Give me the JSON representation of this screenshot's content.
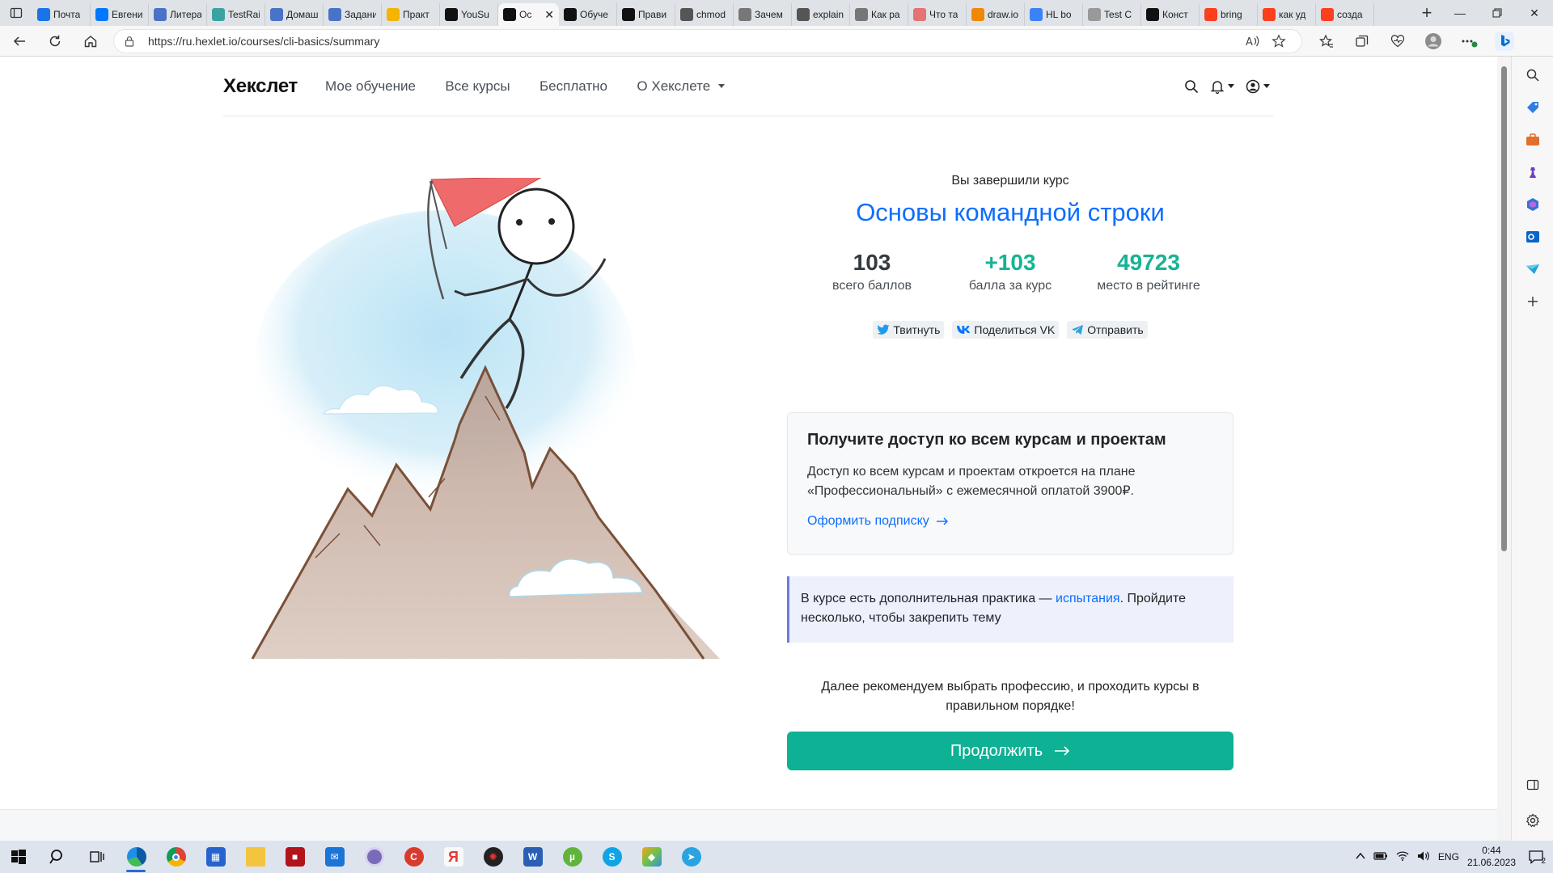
{
  "browser": {
    "tabs": [
      {
        "title": "",
        "favicon": "tab-actions-icon"
      },
      {
        "title": "Почта",
        "favicon": "mail-icon",
        "color": "#1a73e8"
      },
      {
        "title": "Евгений",
        "favicon": "vk-icon",
        "color": "#0077ff"
      },
      {
        "title": "Литера",
        "favicon": "doc-icon",
        "color": "#4a73c6"
      },
      {
        "title": "TestRail",
        "favicon": "testrail-icon",
        "color": "#3aa3a0"
      },
      {
        "title": "Домашн",
        "favicon": "doc-icon",
        "color": "#4a73c6"
      },
      {
        "title": "Задани",
        "favicon": "doc-icon",
        "color": "#4a73c6"
      },
      {
        "title": "Практ",
        "favicon": "drive-icon",
        "color": "#f4b400"
      },
      {
        "title": "YouSu",
        "favicon": "github-icon",
        "color": "#111111"
      },
      {
        "title": "Ос",
        "favicon": "hexlet-icon",
        "color": "#111111",
        "active": true
      },
      {
        "title": "Обуче",
        "favicon": "hexlet-icon",
        "color": "#111111"
      },
      {
        "title": "Прави",
        "favicon": "hexlet-icon",
        "color": "#111111"
      },
      {
        "title": "chmod",
        "favicon": "wikipedia-icon",
        "color": "#555555"
      },
      {
        "title": "Зачем",
        "favicon": "hexlet-icon",
        "color": "#777777"
      },
      {
        "title": "explain",
        "favicon": "feather-icon",
        "color": "#555555"
      },
      {
        "title": "Как ра",
        "favicon": "hexlet-icon",
        "color": "#777777"
      },
      {
        "title": "Что та",
        "favicon": "circle-icon",
        "color": "#e57373"
      },
      {
        "title": "draw.io",
        "favicon": "drawio-icon",
        "color": "#f08705"
      },
      {
        "title": "HL bo",
        "favicon": "diamond-icon",
        "color": "#3b82f6"
      },
      {
        "title": "Test C",
        "favicon": "page-icon",
        "color": "#999999"
      },
      {
        "title": "Конст",
        "favicon": "check-icon",
        "color": "#111111"
      },
      {
        "title": "bring",
        "favicon": "yandex-icon",
        "color": "#fc3f1d"
      },
      {
        "title": "как уд",
        "favicon": "yandex-icon",
        "color": "#fc3f1d"
      },
      {
        "title": "созда",
        "favicon": "yandex-icon",
        "color": "#fc3f1d"
      }
    ],
    "url": "https://ru.hexlet.io/courses/cli-basics/summary"
  },
  "site": {
    "logo": "Хекслет",
    "nav": [
      "Мое обучение",
      "Все курсы",
      "Бесплатно",
      "О Хекслете"
    ]
  },
  "summary": {
    "done_label": "Вы завершили курс",
    "course_title": "Основы командной строки",
    "stats": [
      {
        "value": "103",
        "label": "всего баллов",
        "color": "#343a40"
      },
      {
        "value": "+103",
        "label": "балла за курс",
        "color": "#17b394"
      },
      {
        "value": "49723",
        "label": "место в рейтинге",
        "color": "#17b394"
      }
    ],
    "share": [
      "Твитнуть",
      "Поделиться VK",
      "Отправить"
    ]
  },
  "access_card": {
    "title": "Получите доступ ко всем курсам и проектам",
    "text": "Доступ ко всем курсам и проектам откроется на плане «Профессиональный» с ежемесячной оплатой 3900₽.",
    "link": "Оформить подписку"
  },
  "practice_card": {
    "text_before": "В курсе есть дополнительная практика — ",
    "link": "испытания",
    "text_after": ". Пройдите несколько, чтобы закрепить тему"
  },
  "recommend": "Далее рекомендуем выбрать профессию, и проходить курсы в правильном порядке!",
  "continue_label": "Продолжить",
  "taskbar": {
    "lang": "ENG",
    "time": "0:44",
    "date": "21.06.2023",
    "notifications": "2",
    "apps": [
      {
        "name": "search-icon"
      },
      {
        "name": "task-view-icon"
      },
      {
        "name": "edge-icon",
        "active": true
      },
      {
        "name": "chrome-icon"
      },
      {
        "name": "store-icon"
      },
      {
        "name": "folder-icon"
      },
      {
        "name": "red-app-icon"
      },
      {
        "name": "mail-icon"
      },
      {
        "name": "opera-icon"
      },
      {
        "name": "ccleaner-icon"
      },
      {
        "name": "yandex-browser-icon"
      },
      {
        "name": "davinci-icon"
      },
      {
        "name": "word-icon"
      },
      {
        "name": "utorrent-icon"
      },
      {
        "name": "skype-icon"
      },
      {
        "name": "postman-icon"
      },
      {
        "name": "telegram-icon"
      }
    ]
  }
}
